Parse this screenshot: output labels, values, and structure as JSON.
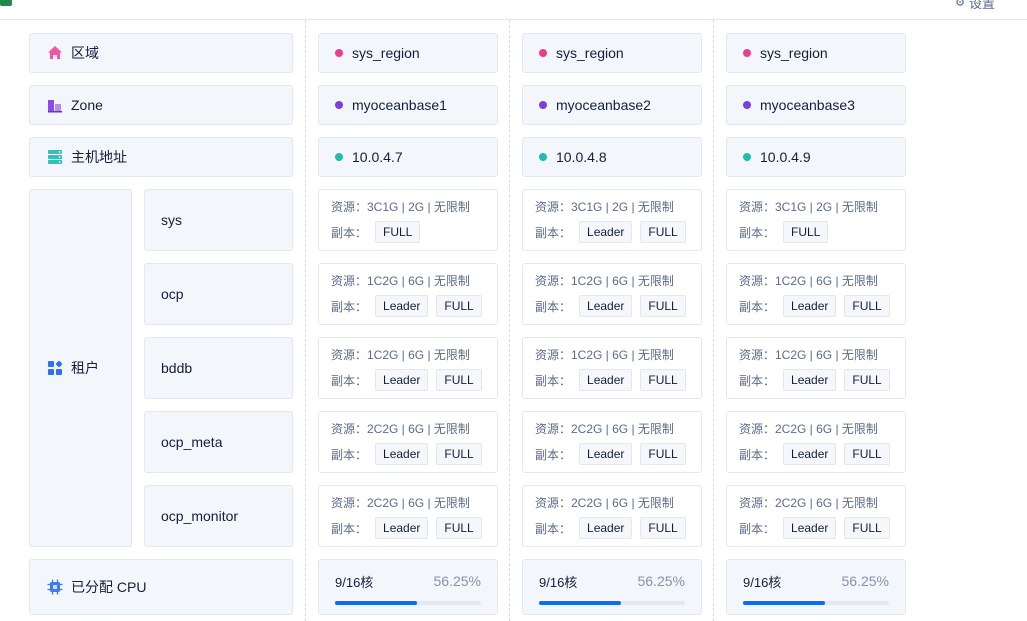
{
  "header": {
    "settings_label": "设置"
  },
  "row_labels": {
    "region": "区域",
    "zone": "Zone",
    "host": "主机地址",
    "tenant": "租户",
    "cpu": "已分配 CPU"
  },
  "colors": {
    "region_dot": "#eb3d8f",
    "zone_dot": "#7a3fe0",
    "host_dot": "#1fbcb0",
    "progress": "#0d6cf2"
  },
  "tenants": [
    "sys",
    "ocp",
    "bddb",
    "ocp_meta",
    "ocp_monitor"
  ],
  "resource_prefix": "资源：",
  "replica_prefix": "副本：",
  "zones": [
    {
      "region": "sys_region",
      "zone": "myoceanbase1",
      "host": "10.0.4.7",
      "tenants": [
        {
          "resource": "3C1G | 2G | 无限制",
          "replicas": [
            "FULL"
          ]
        },
        {
          "resource": "1C2G | 6G | 无限制",
          "replicas": [
            "Leader",
            "FULL"
          ]
        },
        {
          "resource": "1C2G | 6G | 无限制",
          "replicas": [
            "Leader",
            "FULL"
          ]
        },
        {
          "resource": "2C2G | 6G | 无限制",
          "replicas": [
            "Leader",
            "FULL"
          ]
        },
        {
          "resource": "2C2G | 6G | 无限制",
          "replicas": [
            "Leader",
            "FULL"
          ]
        }
      ],
      "cpu": {
        "count": "9/16核",
        "percent": "56.25%",
        "ratio": 0.5625
      }
    },
    {
      "region": "sys_region",
      "zone": "myoceanbase2",
      "host": "10.0.4.8",
      "tenants": [
        {
          "resource": "3C1G | 2G | 无限制",
          "replicas": [
            "Leader",
            "FULL"
          ]
        },
        {
          "resource": "1C2G | 6G | 无限制",
          "replicas": [
            "Leader",
            "FULL"
          ]
        },
        {
          "resource": "1C2G | 6G | 无限制",
          "replicas": [
            "Leader",
            "FULL"
          ]
        },
        {
          "resource": "2C2G | 6G | 无限制",
          "replicas": [
            "Leader",
            "FULL"
          ]
        },
        {
          "resource": "2C2G | 6G | 无限制",
          "replicas": [
            "Leader",
            "FULL"
          ]
        }
      ],
      "cpu": {
        "count": "9/16核",
        "percent": "56.25%",
        "ratio": 0.5625
      }
    },
    {
      "region": "sys_region",
      "zone": "myoceanbase3",
      "host": "10.0.4.9",
      "tenants": [
        {
          "resource": "3C1G | 2G | 无限制",
          "replicas": [
            "FULL"
          ]
        },
        {
          "resource": "1C2G | 6G | 无限制",
          "replicas": [
            "Leader",
            "FULL"
          ]
        },
        {
          "resource": "1C2G | 6G | 无限制",
          "replicas": [
            "Leader",
            "FULL"
          ]
        },
        {
          "resource": "2C2G | 6G | 无限制",
          "replicas": [
            "Leader",
            "FULL"
          ]
        },
        {
          "resource": "2C2G | 6G | 无限制",
          "replicas": [
            "Leader",
            "FULL"
          ]
        }
      ],
      "cpu": {
        "count": "9/16核",
        "percent": "56.25%",
        "ratio": 0.5625
      }
    }
  ]
}
